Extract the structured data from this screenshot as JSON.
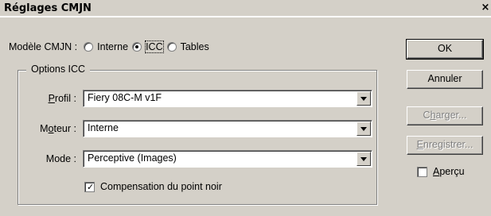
{
  "window": {
    "title": "Réglages CMJN",
    "close_symbol": "×"
  },
  "model": {
    "label": "Modèle CMJN :",
    "options": [
      {
        "label": "Interne",
        "selected": false
      },
      {
        "label": "ICC",
        "selected": true
      },
      {
        "label": "Tables",
        "selected": false
      }
    ]
  },
  "icc_options": {
    "legend": "Options ICC",
    "profile": {
      "label_pre": "",
      "label_u": "P",
      "label_post": "rofil :",
      "value": "Fiery 08C-M v1F"
    },
    "engine": {
      "label_pre": "M",
      "label_u": "o",
      "label_post": "teur :",
      "value": "Interne"
    },
    "mode": {
      "label": "Mode :",
      "value": "Perceptive (Images)"
    },
    "black_point": {
      "label": "Compensation du point noir",
      "checked": true,
      "check_symbol": "✓"
    }
  },
  "buttons": {
    "ok": "OK",
    "cancel": "Annuler",
    "load": {
      "pre": "C",
      "u": "h",
      "post": "arger..."
    },
    "save": {
      "pre": "",
      "u": "E",
      "post": "nregistrer..."
    }
  },
  "preview": {
    "pre": "",
    "u": "A",
    "post": "perçu",
    "checked": false
  }
}
